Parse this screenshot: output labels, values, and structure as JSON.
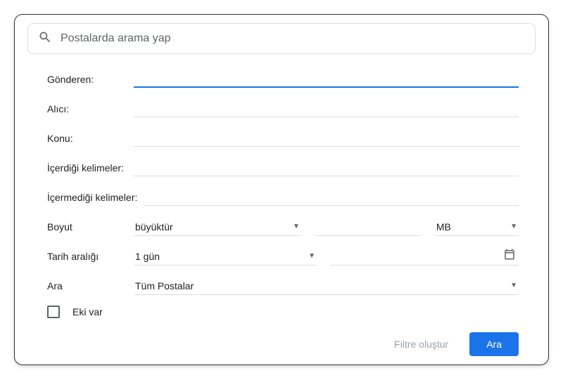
{
  "search": {
    "placeholder": "Postalarda arama yap"
  },
  "form": {
    "from_label": "Gönderen:",
    "to_label": "Alıcı:",
    "subject_label": "Konu:",
    "contains_label": "İçerdiği kelimeler:",
    "not_contains_label": "İçermediği kelimeler:",
    "size_label": "Boyut",
    "size_comparator": "büyüktür",
    "size_unit": "MB",
    "date_label": "Tarih aralığı",
    "date_range": "1 gün",
    "search_in_label": "Ara",
    "search_in_value": "Tüm Postalar",
    "has_attachment_label": "Eki var"
  },
  "actions": {
    "create_filter": "Filtre oluştur",
    "search": "Ara"
  }
}
